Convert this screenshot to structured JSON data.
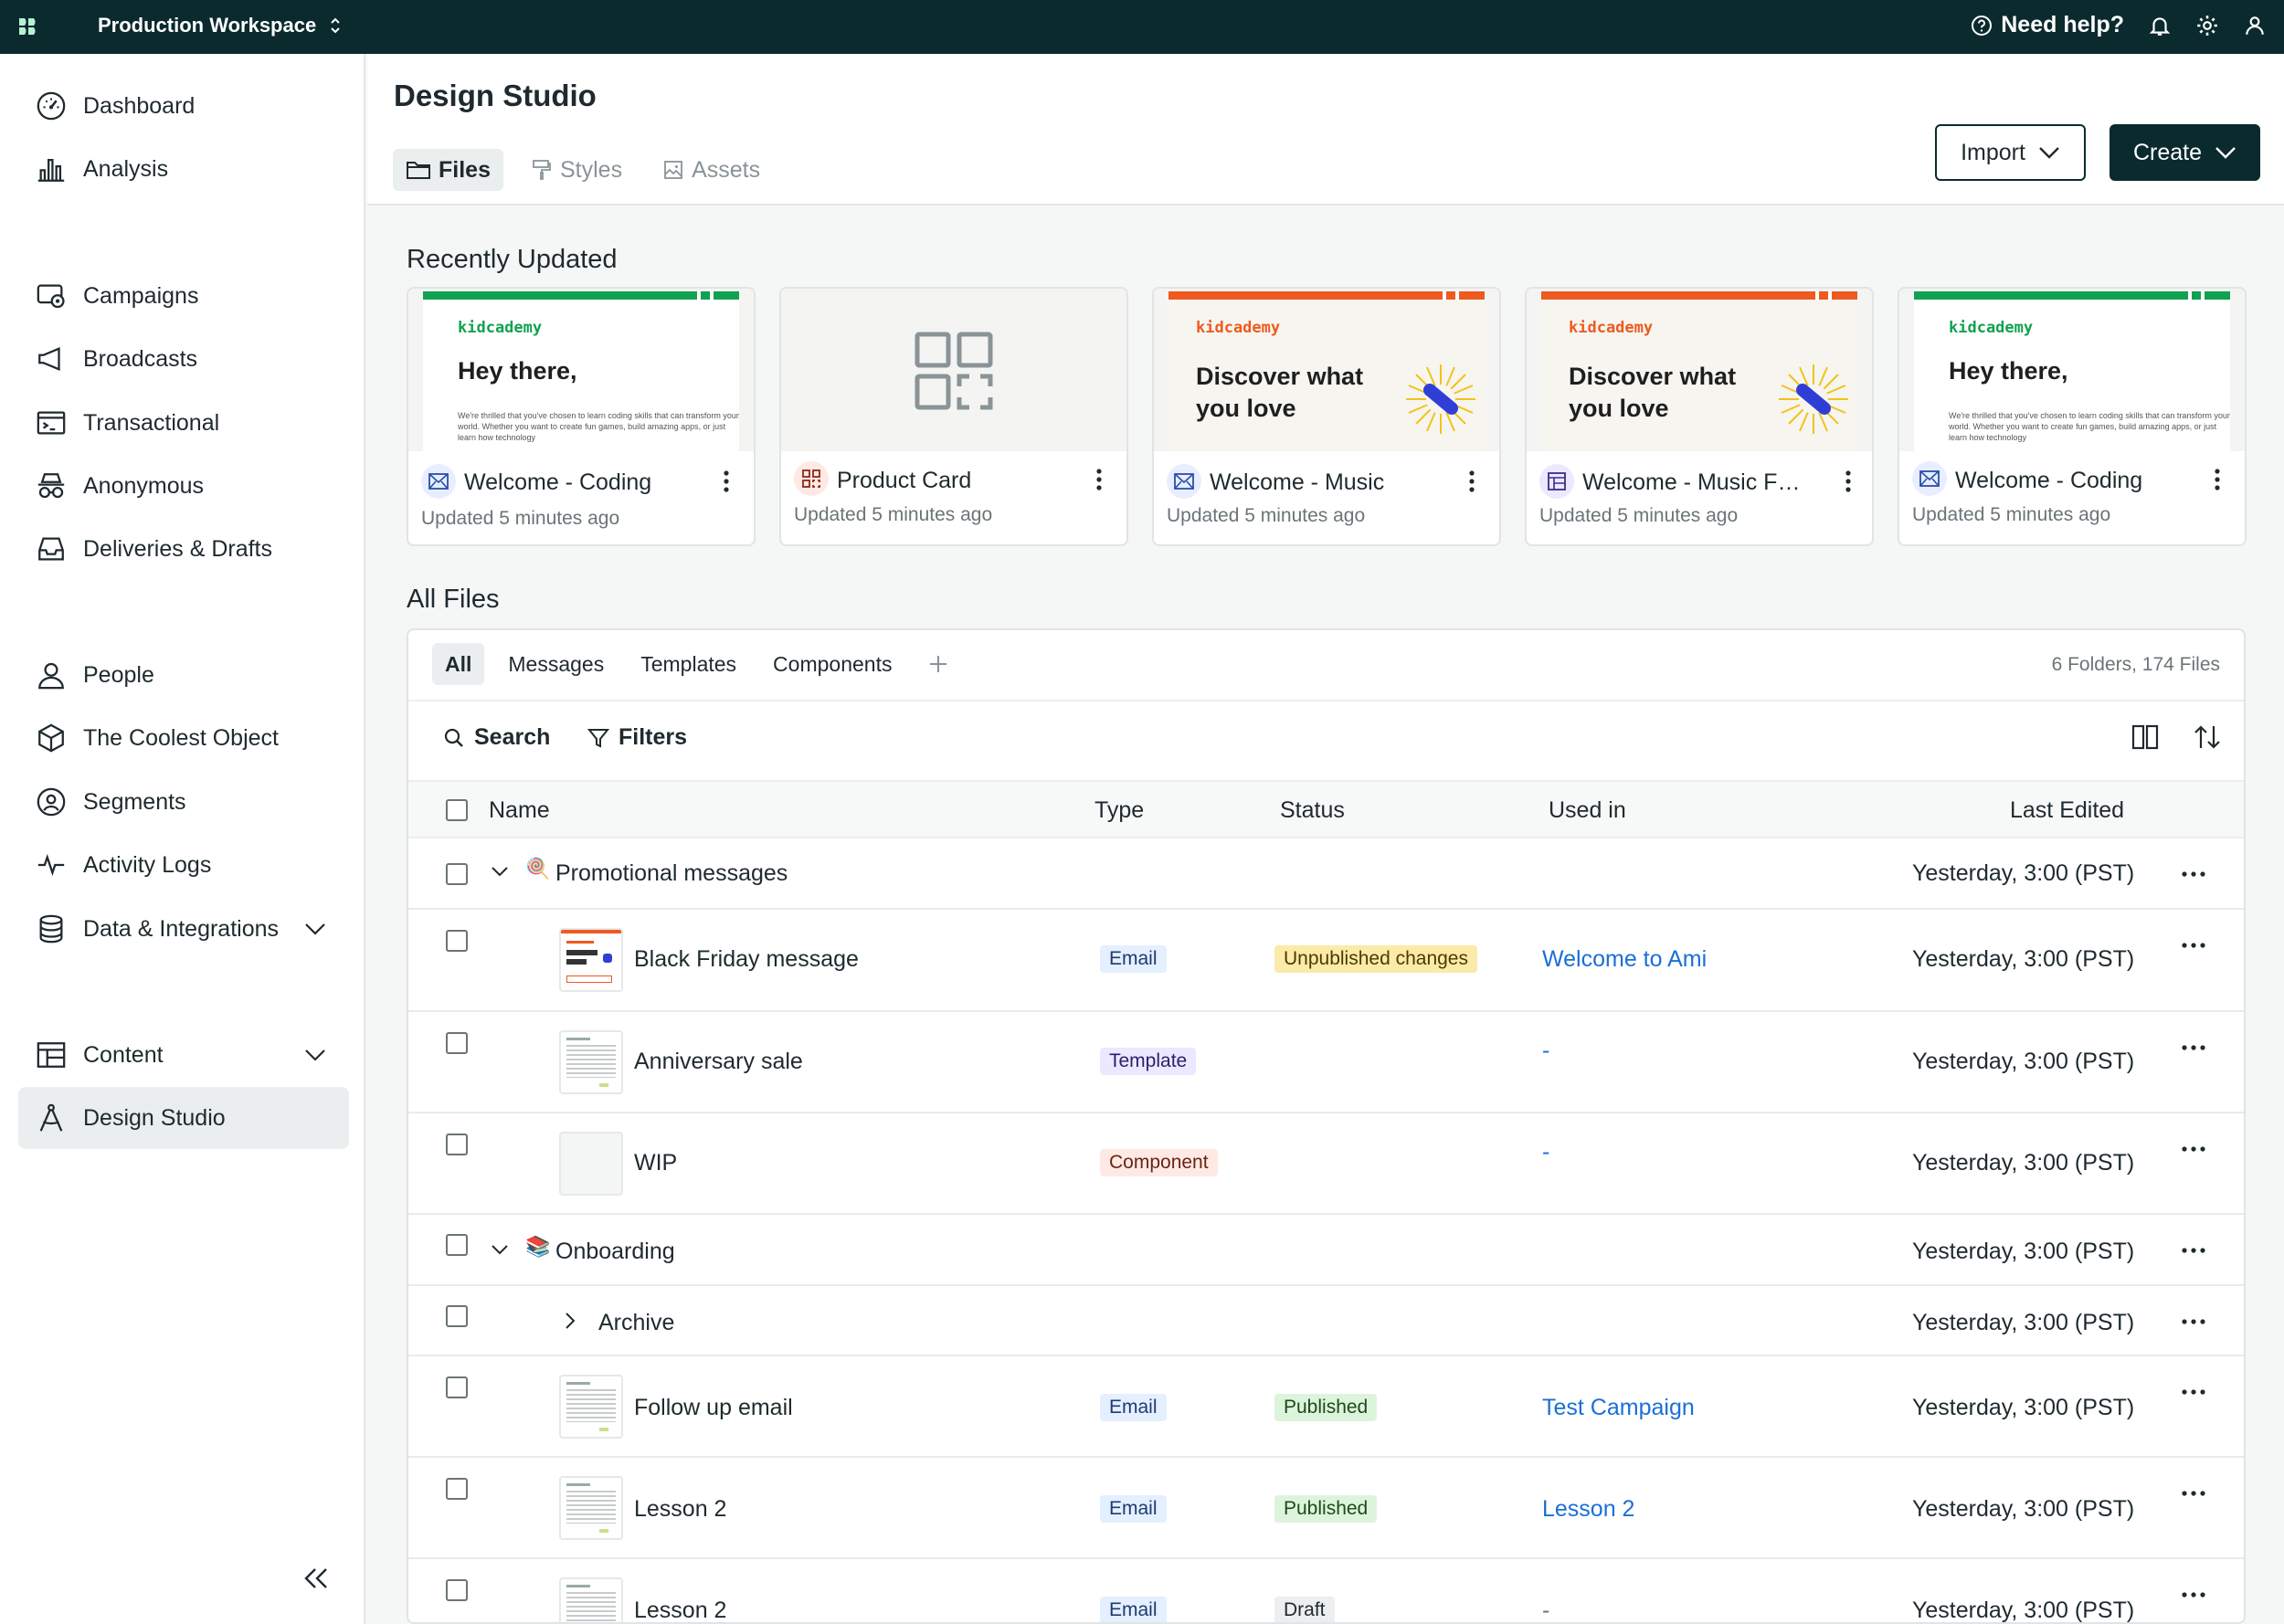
{
  "topbar": {
    "workspace": "Production Workspace",
    "help": "Need help?",
    "icons": [
      "logo-icon",
      "help-circle-icon",
      "bell-icon",
      "gear-icon",
      "user-icon"
    ]
  },
  "sidebar": {
    "items": [
      {
        "label": "Dashboard",
        "icon": "gauge-icon"
      },
      {
        "label": "Analysis",
        "icon": "bar-chart-icon"
      },
      {
        "label": "Campaigns",
        "icon": "campaign-icon"
      },
      {
        "label": "Broadcasts",
        "icon": "megaphone-icon"
      },
      {
        "label": "Transactional",
        "icon": "terminal-icon"
      },
      {
        "label": "Anonymous",
        "icon": "incognito-icon"
      },
      {
        "label": "Deliveries & Drafts",
        "icon": "inbox-icon"
      },
      {
        "label": "People",
        "icon": "person-icon"
      },
      {
        "label": "The Coolest Object",
        "icon": "cube-icon"
      },
      {
        "label": "Segments",
        "icon": "segment-icon"
      },
      {
        "label": "Activity Logs",
        "icon": "pulse-icon"
      },
      {
        "label": "Data & Integrations",
        "icon": "database-icon"
      },
      {
        "label": "Content",
        "icon": "layout-icon"
      },
      {
        "label": "Design Studio",
        "icon": "compass-icon"
      }
    ]
  },
  "header": {
    "title": "Design Studio",
    "tabs": [
      {
        "label": "Files"
      },
      {
        "label": "Styles"
      },
      {
        "label": "Assets"
      }
    ],
    "import_label": "Import",
    "create_label": "Create"
  },
  "recent": {
    "title": "Recently Updated",
    "cards": [
      {
        "name": "Welcome - Coding",
        "updated": "Updated 5 minutes ago",
        "brand": "kidcademy",
        "headline": "Hey there,",
        "body": "We're thrilled that you've chosen to learn coding skills that can transform your world. Whether you want to create fun games, build amazing apps, or just learn how technology",
        "accent": "#12a150"
      },
      {
        "name": "Product Card",
        "updated": "Updated 5 minutes ago"
      },
      {
        "name": "Welcome - Music",
        "updated": "Updated 5 minutes ago",
        "brand": "kidcademy",
        "headline_1": "Discover what",
        "headline_2": "you love",
        "accent": "#ee5a1f"
      },
      {
        "name": "Welcome - Music Foll...",
        "updated": "Updated 5 minutes ago",
        "brand": "kidcademy",
        "headline_1": "Discover what",
        "headline_2": "you love",
        "accent": "#ee5a1f"
      },
      {
        "name": "Welcome - Coding",
        "updated": "Updated 5 minutes ago",
        "brand": "kidcademy",
        "headline": "Hey there,",
        "body": "We're thrilled that you've chosen to learn coding skills that can transform your world. Whether you want to create fun games, build amazing apps, or just learn how technology",
        "accent": "#12a150"
      }
    ]
  },
  "files": {
    "title": "All Files",
    "tabs": [
      "All",
      "Messages",
      "Templates",
      "Components"
    ],
    "count": "6 Folders, 174 Files",
    "search_label": "Search",
    "filters_label": "Filters",
    "columns": {
      "name": "Name",
      "type": "Type",
      "status": "Status",
      "used_in": "Used in",
      "last_edited": "Last Edited"
    },
    "rows": [
      {
        "name": "Promotional messages",
        "kind": "folder",
        "emoji": "🍭",
        "type": "",
        "status": "",
        "used_in": "",
        "edited": "Yesterday, 3:00 (PST)"
      },
      {
        "name": "Black Friday message",
        "kind": "file",
        "type": "Email",
        "status": "Unpublished changes",
        "used_in": "Welcome to Ami",
        "edited": "Yesterday, 3:00 (PST)"
      },
      {
        "name": "Anniversary sale",
        "kind": "file",
        "type": "Template",
        "status": "",
        "used_in": "-",
        "edited": "Yesterday, 3:00 (PST)"
      },
      {
        "name": "WIP",
        "kind": "file",
        "type": "Component",
        "status": "",
        "used_in": "-",
        "edited": "Yesterday, 3:00 (PST)"
      },
      {
        "name": "Onboarding",
        "kind": "folder",
        "emoji": "📚",
        "type": "",
        "status": "",
        "used_in": "",
        "edited": "Yesterday, 3:00 (PST)"
      },
      {
        "name": "Archive",
        "kind": "subfolder",
        "type": "",
        "status": "",
        "used_in": "",
        "edited": "Yesterday, 3:00 (PST)"
      },
      {
        "name": "Follow up email",
        "kind": "file",
        "type": "Email",
        "status": "Published",
        "used_in": "Test Campaign",
        "edited": "Yesterday, 3:00 (PST)"
      },
      {
        "name": "Lesson 2",
        "kind": "file",
        "type": "Email",
        "status": "Published",
        "used_in": "Lesson 2",
        "edited": "Yesterday, 3:00 (PST)"
      },
      {
        "name": "Lesson 2",
        "kind": "file",
        "type": "Email",
        "status": "Draft",
        "used_in": "-",
        "edited": "Yesterday, 3:00 (PST)"
      }
    ]
  }
}
